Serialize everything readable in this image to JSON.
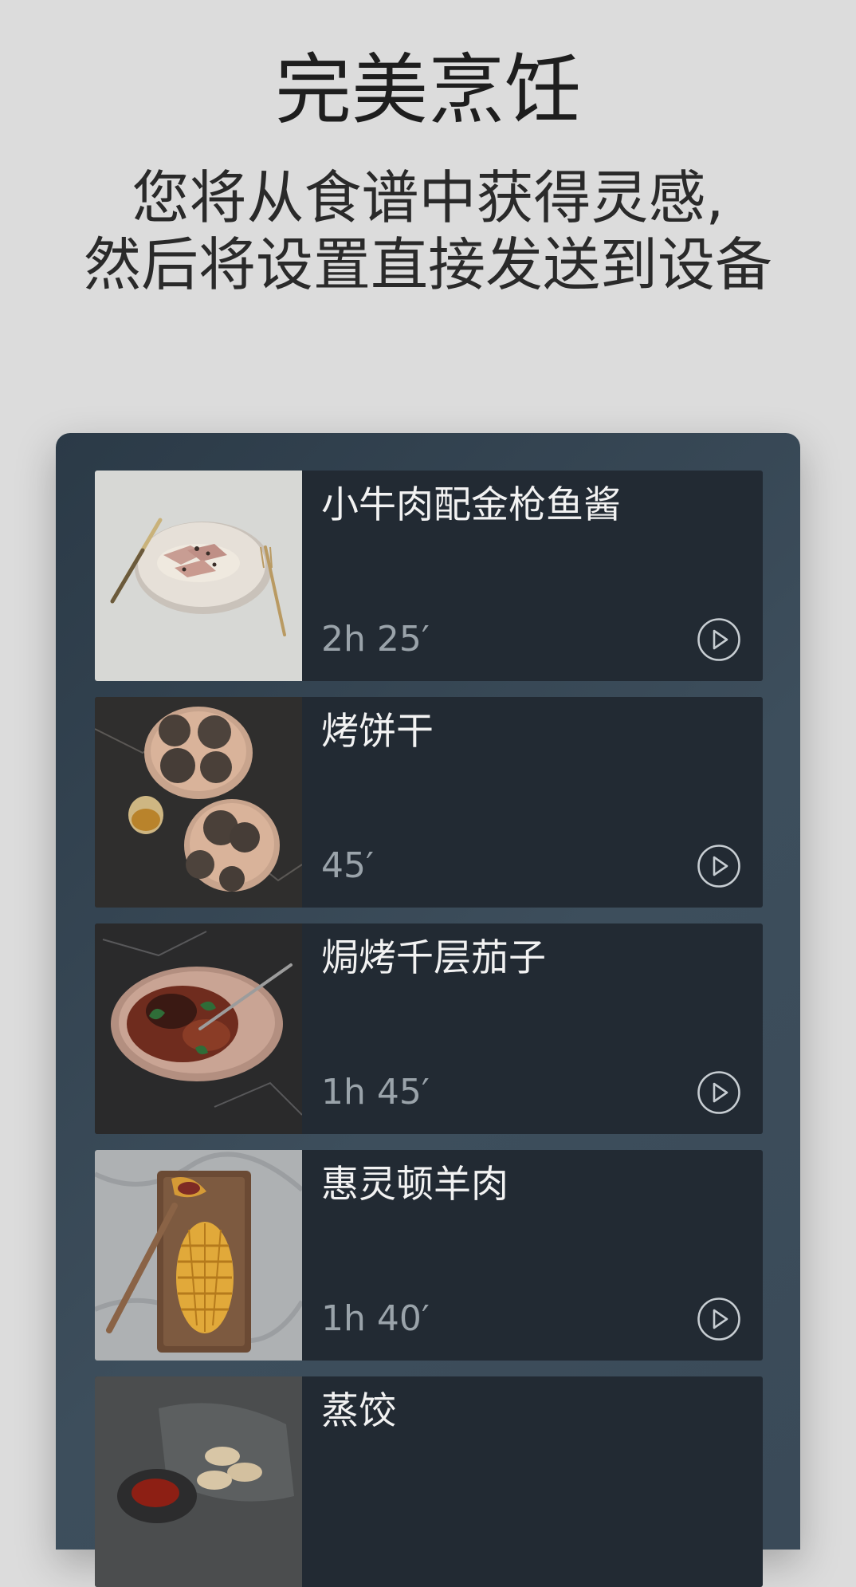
{
  "header": {
    "title": "完美烹饪",
    "subtitle_line1": "您将从食谱中获得灵感,",
    "subtitle_line2": "然后将设置直接发送到设备"
  },
  "recipes": [
    {
      "name": "小牛肉配金枪鱼酱",
      "time": "2h 25′",
      "icon": "play-icon"
    },
    {
      "name": "烤饼干",
      "time": "45′",
      "icon": "play-icon"
    },
    {
      "name": "焗烤千层茄子",
      "time": "1h 45′",
      "icon": "play-icon"
    },
    {
      "name": "惠灵顿羊肉",
      "time": "1h 40′",
      "icon": "play-icon"
    },
    {
      "name": "蒸饺",
      "time": "",
      "icon": "play-icon"
    }
  ],
  "colors": {
    "background": "#dcdcdc",
    "panel": "#34434f",
    "card": "#222a33",
    "title_text": "#1e1e1e",
    "recipe_text": "#f2f2f2",
    "time_text": "#9aa3aa"
  }
}
